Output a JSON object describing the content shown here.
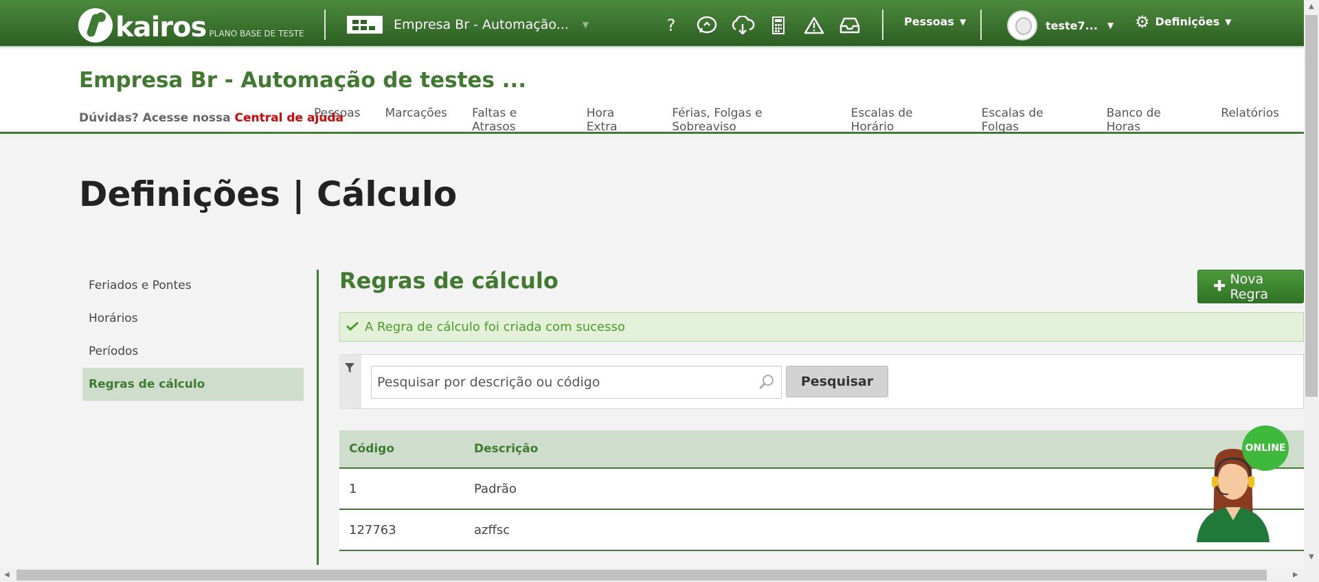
{
  "topbar": {
    "logo_text": "kairos",
    "plan_label": "PLANO BASE DE TESTE",
    "company_selector": "Empresa Br - Automação...",
    "icons": [
      "help-icon",
      "chat-support-icon",
      "cloud-sync-icon",
      "calculator-icon",
      "warning-icon",
      "inbox-icon"
    ],
    "people_menu": "Pessoas",
    "user_menu": "teste7...",
    "settings_menu": "Definições"
  },
  "header": {
    "company_title": "Empresa Br - Automação de testes ...",
    "help_prefix": "Dúvidas? Acesse nossa",
    "help_link": "Central de ajuda",
    "nav": [
      "Pessoas",
      "Marcações",
      "Faltas e Atrasos",
      "Hora Extra",
      "Férias, Folgas e Sobreaviso",
      "Escalas de Horário",
      "Escalas de Folgas",
      "Banco de Horas",
      "Relatórios"
    ]
  },
  "page": {
    "heading": "Definições | Cálculo"
  },
  "sidebar": {
    "items": [
      "Feriados e Pontes",
      "Horários",
      "Períodos",
      "Regras de cálculo"
    ],
    "active": "Regras de cálculo"
  },
  "panel": {
    "title": "Regras de cálculo",
    "new_button": "Nova Regra",
    "success_message": "A Regra de cálculo foi criada com sucesso",
    "search_placeholder": "Pesquisar por descrição ou código",
    "search_button": "Pesquisar"
  },
  "table": {
    "columns": [
      "Código",
      "Descrição"
    ],
    "rows": [
      {
        "code": "1",
        "description": "Padrão"
      },
      {
        "code": "127763",
        "description": "azffsc"
      }
    ]
  },
  "chat_widget": {
    "status": "ONLINE"
  },
  "colors": {
    "brand_green": "#3d7a32",
    "help_link": "#e00000",
    "success_bg": "#e3f1d8",
    "online_badge": "#3fb93b"
  }
}
